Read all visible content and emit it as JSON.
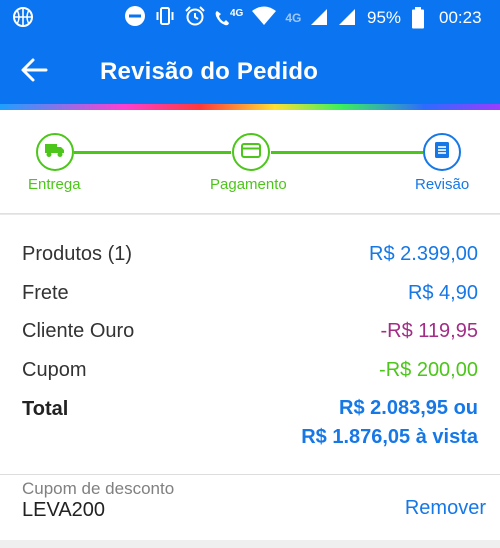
{
  "status_bar": {
    "network_label": "4G",
    "network_label_dim": "4G",
    "battery_percent": "95%",
    "time": "00:23"
  },
  "app_bar": {
    "title": "Revisão do Pedido",
    "back_icon": "arrow-left-icon"
  },
  "stepper": {
    "steps": [
      {
        "label": "Entrega",
        "icon": "truck-icon",
        "state": "done"
      },
      {
        "label": "Pagamento",
        "icon": "credit-card-icon",
        "state": "done"
      },
      {
        "label": "Revisão",
        "icon": "list-icon",
        "state": "current"
      }
    ]
  },
  "summary": {
    "products_label": "Produtos (1)",
    "products_value": "R$ 2.399,00",
    "shipping_label": "Frete",
    "shipping_value": "R$ 4,90",
    "gold_label": "Cliente Ouro",
    "gold_value": "-R$ 119,95",
    "coupon_label": "Cupom",
    "coupon_value": "-R$ 200,00",
    "total_label": "Total",
    "total_value_line1": "R$ 2.083,95 ou",
    "total_value_line2": "R$ 1.876,05 à vista"
  },
  "coupon": {
    "field_label": "Cupom de desconto",
    "code": "LEVA200",
    "remove_label": "Remover"
  },
  "colors": {
    "primary": "#0b74f0",
    "step_green": "#4cc61a",
    "value_blue": "#1678e6",
    "discount_purple": "#a22d87"
  }
}
